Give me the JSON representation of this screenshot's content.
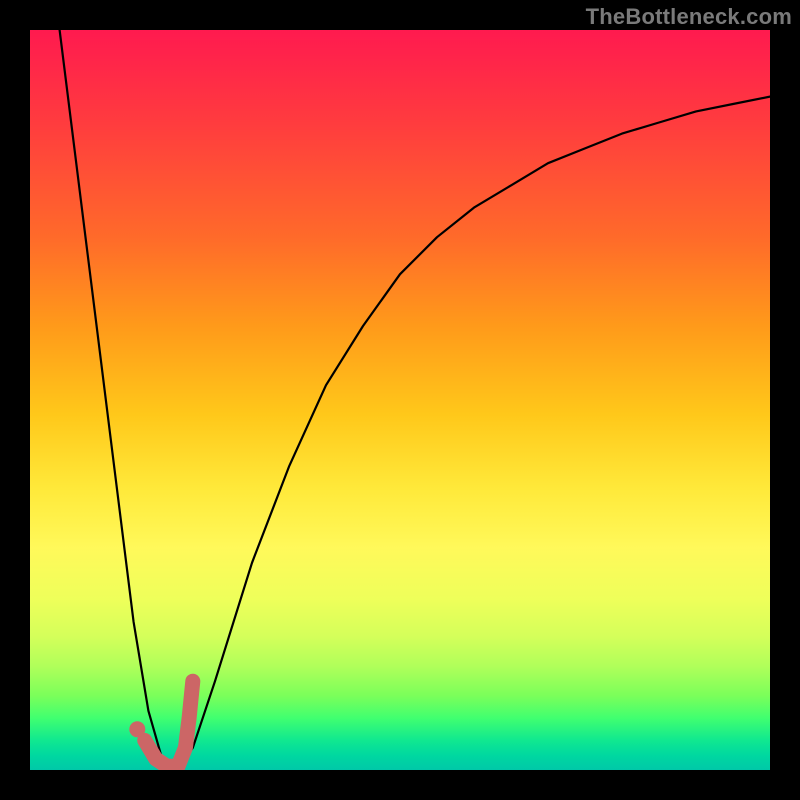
{
  "watermark": "TheBottleneck.com",
  "chart_data": {
    "type": "line",
    "title": "",
    "xlabel": "",
    "ylabel": "",
    "xlim": [
      0,
      100
    ],
    "ylim": [
      0,
      100
    ],
    "grid": false,
    "legend": false,
    "series": [
      {
        "name": "bottleneck-curve",
        "color": "#000000",
        "x": [
          4,
          6,
          8,
          10,
          12,
          14,
          16,
          18,
          20,
          22,
          25,
          30,
          35,
          40,
          45,
          50,
          55,
          60,
          65,
          70,
          75,
          80,
          85,
          90,
          95,
          100
        ],
        "y": [
          100,
          84,
          68,
          52,
          36,
          20,
          8,
          1,
          0,
          3,
          12,
          28,
          41,
          52,
          60,
          67,
          72,
          76,
          79,
          82,
          84,
          86,
          87.5,
          89,
          90,
          91
        ]
      },
      {
        "name": "highlight-segment",
        "color": "#cc6666",
        "x": [
          15.5,
          17,
          18.5,
          20,
          21,
          21.5,
          22
        ],
        "y": [
          4,
          1.5,
          0.5,
          0.5,
          3,
          7,
          12
        ]
      },
      {
        "name": "highlight-point",
        "color": "#cc6666",
        "type": "scatter",
        "x": [
          14.5
        ],
        "y": [
          5.5
        ]
      }
    ]
  }
}
